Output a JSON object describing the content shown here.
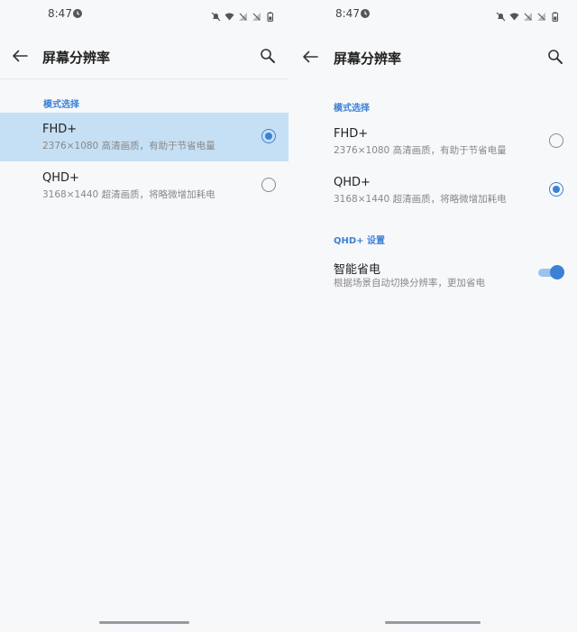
{
  "left": {
    "status_bar": {
      "time": "8:47"
    },
    "app_bar": {
      "title": "屏幕分辨率"
    },
    "section_mode": "模式选择",
    "options": [
      {
        "title": "FHD+",
        "subtitle": "2376×1080 高清画质，有助于节省电量",
        "selected": true
      },
      {
        "title": "QHD+",
        "subtitle": "3168×1440 超清画质，将略微增加耗电",
        "selected": false
      }
    ]
  },
  "right": {
    "status_bar": {
      "time": "8:47"
    },
    "app_bar": {
      "title": "屏幕分辨率"
    },
    "section_mode": "模式选择",
    "options": [
      {
        "title": "FHD+",
        "subtitle": "2376×1080 高清画质，有助于节省电量",
        "selected": false
      },
      {
        "title": "QHD+",
        "subtitle": "3168×1440 超清画质，将略微增加耗电",
        "selected": true
      }
    ],
    "section_qhd": "QHD+ 设置",
    "smart_power": {
      "title": "智能省电",
      "subtitle": "根据场景自动切换分辨率，更加省电",
      "enabled": true
    }
  },
  "colors": {
    "accent": "#3b82d6",
    "selected_row_bg": "#c5dff4",
    "background": "#f7f8fa"
  }
}
